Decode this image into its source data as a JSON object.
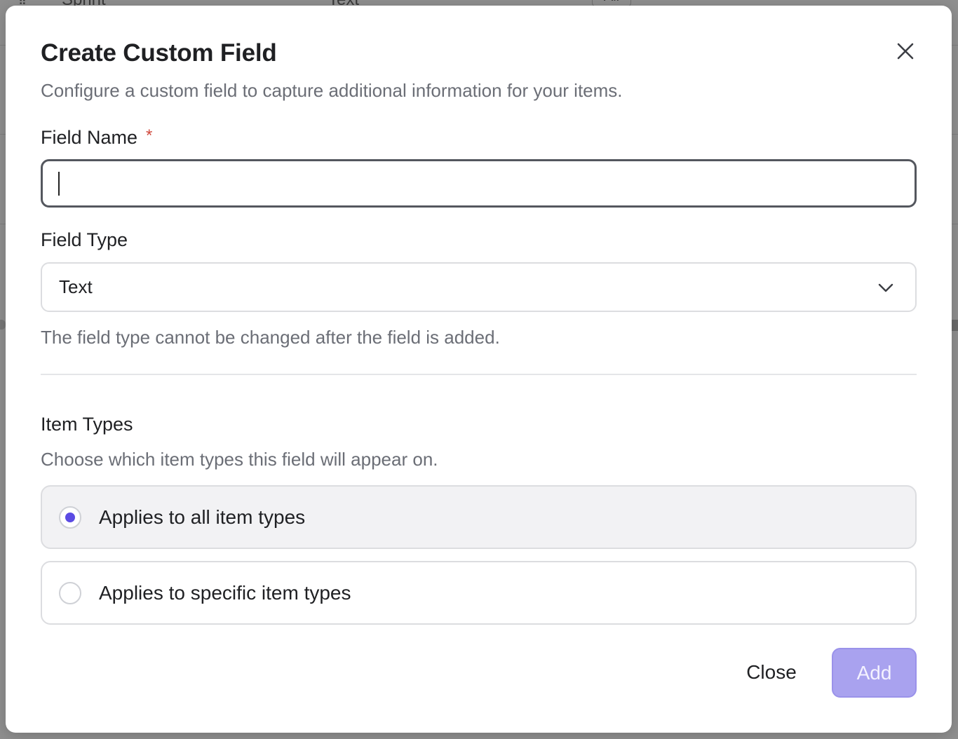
{
  "background": {
    "row_labels": [
      "Sprint",
      "Text",
      "All"
    ]
  },
  "dialog": {
    "title": "Create Custom Field",
    "subtitle": "Configure a custom field to capture additional information for your items.",
    "field_name": {
      "label": "Field Name",
      "required_mark": "*",
      "value": "",
      "placeholder": ""
    },
    "field_type": {
      "label": "Field Type",
      "selected": "Text",
      "help": "The field type cannot be changed after the field is added."
    },
    "item_types": {
      "label": "Item Types",
      "description": "Choose which item types this field will appear on.",
      "options": [
        {
          "label": "Applies to all item types",
          "checked": true
        },
        {
          "label": "Applies to specific item types",
          "checked": false
        }
      ]
    },
    "buttons": {
      "close": "Close",
      "add": "Add"
    }
  },
  "colors": {
    "accent": "#5b4be3",
    "add_button_disabled": "#a9a2ef",
    "required": "#d04a3e"
  },
  "icons": {
    "close": "close-icon",
    "chevron": "chevron-down-icon"
  }
}
